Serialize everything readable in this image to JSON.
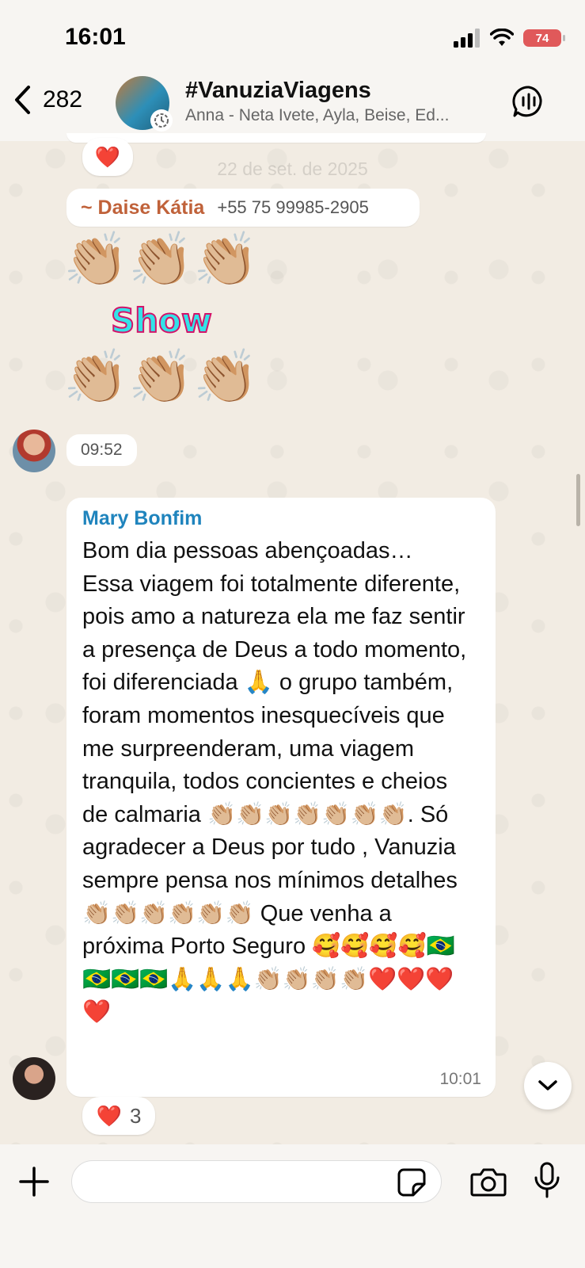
{
  "status_bar": {
    "time": "16:01",
    "battery": "74"
  },
  "header": {
    "back_count": "282",
    "title": "#VanuziaViagens",
    "members": "Anna - Neta Ivete, Ayla, Beise, Ed..."
  },
  "date_separator": "22 de set. de 2025",
  "messages": {
    "top_reaction": "❤️",
    "daise": {
      "sender": "~ Daise Kátia",
      "phone": "+55 75 99985-2905",
      "sticker_text": "Show",
      "sticker_emoji": "👏🏼",
      "time": "09:52"
    },
    "mary": {
      "sender": "Mary Bonfim",
      "text": "Bom dia pessoas abençoadas…\nEssa viagem foi totalmente diferente, pois amo a natureza ela me faz sentir a presença de Deus a todo momento, foi diferenciada 🙏 o grupo também, foram momentos inesquecíveis que me surpreenderam, uma viagem tranquila, todos concientes e cheios de calmaria 👏🏼👏🏼👏🏼👏🏼👏🏼👏🏼👏🏼. Só agradecer a Deus por tudo , Vanuzia sempre pensa nos mínimos detalhes 👏🏼👏🏼👏🏼👏🏼👏🏼👏🏼 Que venha a próxima Porto Seguro 🥰🥰🥰🥰🇧🇷🇧🇷🇧🇷🇧🇷🙏🙏🙏👏🏼👏🏼👏🏼👏🏼❤️❤️❤️❤️",
      "time": "10:01",
      "reaction_emoji": "❤️",
      "reaction_count": "3"
    }
  },
  "input": {
    "placeholder": "",
    "value": ""
  },
  "colors": {
    "daise_name": "#c0623a",
    "mary_name": "#1f84bd",
    "chat_background": "#f2ece3"
  },
  "icons": {
    "back": "chevron-left-icon",
    "call": "group-call-icon",
    "scroll": "chevron-down-icon",
    "plus": "plus-icon",
    "sticker": "sticker-icon",
    "camera": "camera-icon",
    "mic": "microphone-icon"
  }
}
